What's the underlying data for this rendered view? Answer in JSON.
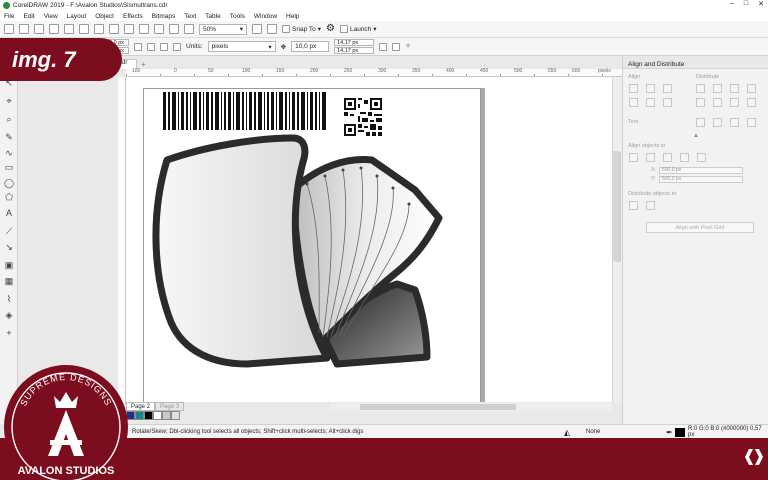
{
  "window": {
    "title": "CorelDRAW 2019 - F:\\Avalon Studios\\Sismultrans.cdr",
    "controls": [
      "–",
      "□",
      "✕"
    ]
  },
  "menu": [
    "File",
    "Edit",
    "View",
    "Layout",
    "Object",
    "Effects",
    "Bitmaps",
    "Text",
    "Table",
    "Tools",
    "Window",
    "Help"
  ],
  "toolbar": {
    "zoom": "50%",
    "snap_to": "Snap To",
    "launch": "Launch"
  },
  "propertybar": {
    "x": "10,0 px",
    "y": "10,0 px",
    "units_label": "Units:",
    "units_value": "pixels",
    "nudge": "10,0 px",
    "dup_x": "14,17 px",
    "dup_y": "14,17 px"
  },
  "document": {
    "tab": "cdr",
    "ruler_ticks": [
      "100",
      "50",
      "0",
      "50",
      "100",
      "150",
      "200",
      "250",
      "300",
      "350",
      "400",
      "450",
      "500",
      "550",
      "600",
      "pixels"
    ]
  },
  "page_tabs": [
    "Page 2",
    "Page 3"
  ],
  "status": {
    "hint": "Rotate/Skew; Dbl-clicking tool selects all objects; Shift+click multi-selects; Alt+click digs",
    "fill": "None",
    "outline": "R:0 G:0 B:0 (#000000)  0,57 px"
  },
  "docker": {
    "title": "Align and Distribute",
    "sections": {
      "align": "Align",
      "distribute": "Distribute",
      "text": "Text",
      "align_objects_to": "Align objects to",
      "distribute_objects_to": "Distribute objects to"
    },
    "x_label": "X:",
    "x_value": "500,0 px",
    "y_label": "Y:",
    "y_value": "500,0 px",
    "pixel_grid_button": "Align with Pixel Grid"
  },
  "overlay": {
    "badge": "img. 7",
    "logo_top": "SUPREME DESIGNS",
    "logo_bottom": "AVALON STUDIOS"
  },
  "colors": {
    "brand": "#7b0d1e",
    "canvas": "#ffffff",
    "docker": "#f2f2f2"
  },
  "palette": [
    "#2a2a8a",
    "#0f8c8c",
    "#000000",
    "#ffffff",
    "#c8c8c8",
    "#e0e0e0"
  ]
}
